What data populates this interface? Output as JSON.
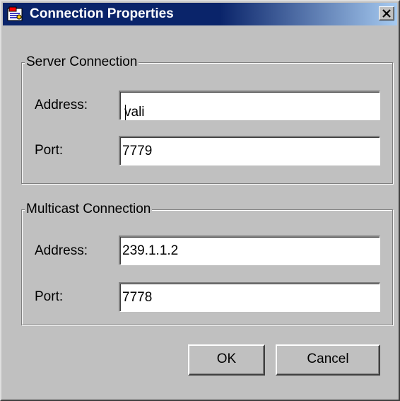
{
  "window": {
    "title": "Connection Properties"
  },
  "server_connection": {
    "group_label": "Server Connection",
    "address_label": "Address:",
    "address_value": "vali",
    "port_label": "Port:",
    "port_value": "7779"
  },
  "multicast_connection": {
    "group_label": "Multicast Connection",
    "address_label": "Address:",
    "address_value": "239.1.1.2",
    "port_label": "Port:",
    "port_value": "7778"
  },
  "buttons": {
    "ok_label": "OK",
    "cancel_label": "Cancel"
  },
  "colors": {
    "titlebar_start": "#0a246a",
    "titlebar_end": "#a6caf0",
    "dialog_face": "#c0c0c0"
  }
}
